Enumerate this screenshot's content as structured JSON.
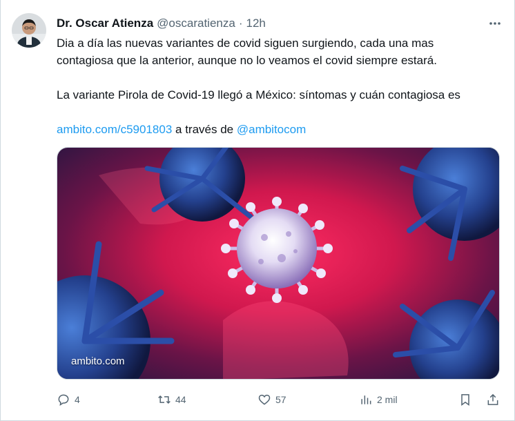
{
  "author": {
    "display_name": "Dr. Oscar Atienza",
    "handle": "@oscaratienza",
    "separator": "·",
    "time": "12h"
  },
  "tweet": {
    "line1": "Dia a día las nuevas variantes de covid siguen surgiendo, cada una mas",
    "line2": "contagiosa que la anterior, aunque no lo veamos el covid siempre estará.",
    "headline": "La variante Pirola de Covid-19 llegó a México: síntomas y cuán contagiosa es",
    "link_url": "ambito.com/c5901803",
    "via_text": "a través de",
    "via_handle": "@ambitocom"
  },
  "media": {
    "watermark": "ambito.com"
  },
  "actions": {
    "replies": "4",
    "retweets": "44",
    "likes": "57",
    "views": "2 mil"
  },
  "icons": {
    "avatar": "avatar-photo",
    "more": "more-dots-icon",
    "reply": "reply-icon",
    "retweet": "retweet-icon",
    "like": "heart-icon",
    "views": "views-chart-icon",
    "bookmark": "bookmark-icon",
    "share": "share-icon"
  },
  "colors": {
    "text": "#0f1419",
    "secondary": "#536471",
    "link": "#1d9bf0",
    "border": "#cfd9de"
  }
}
